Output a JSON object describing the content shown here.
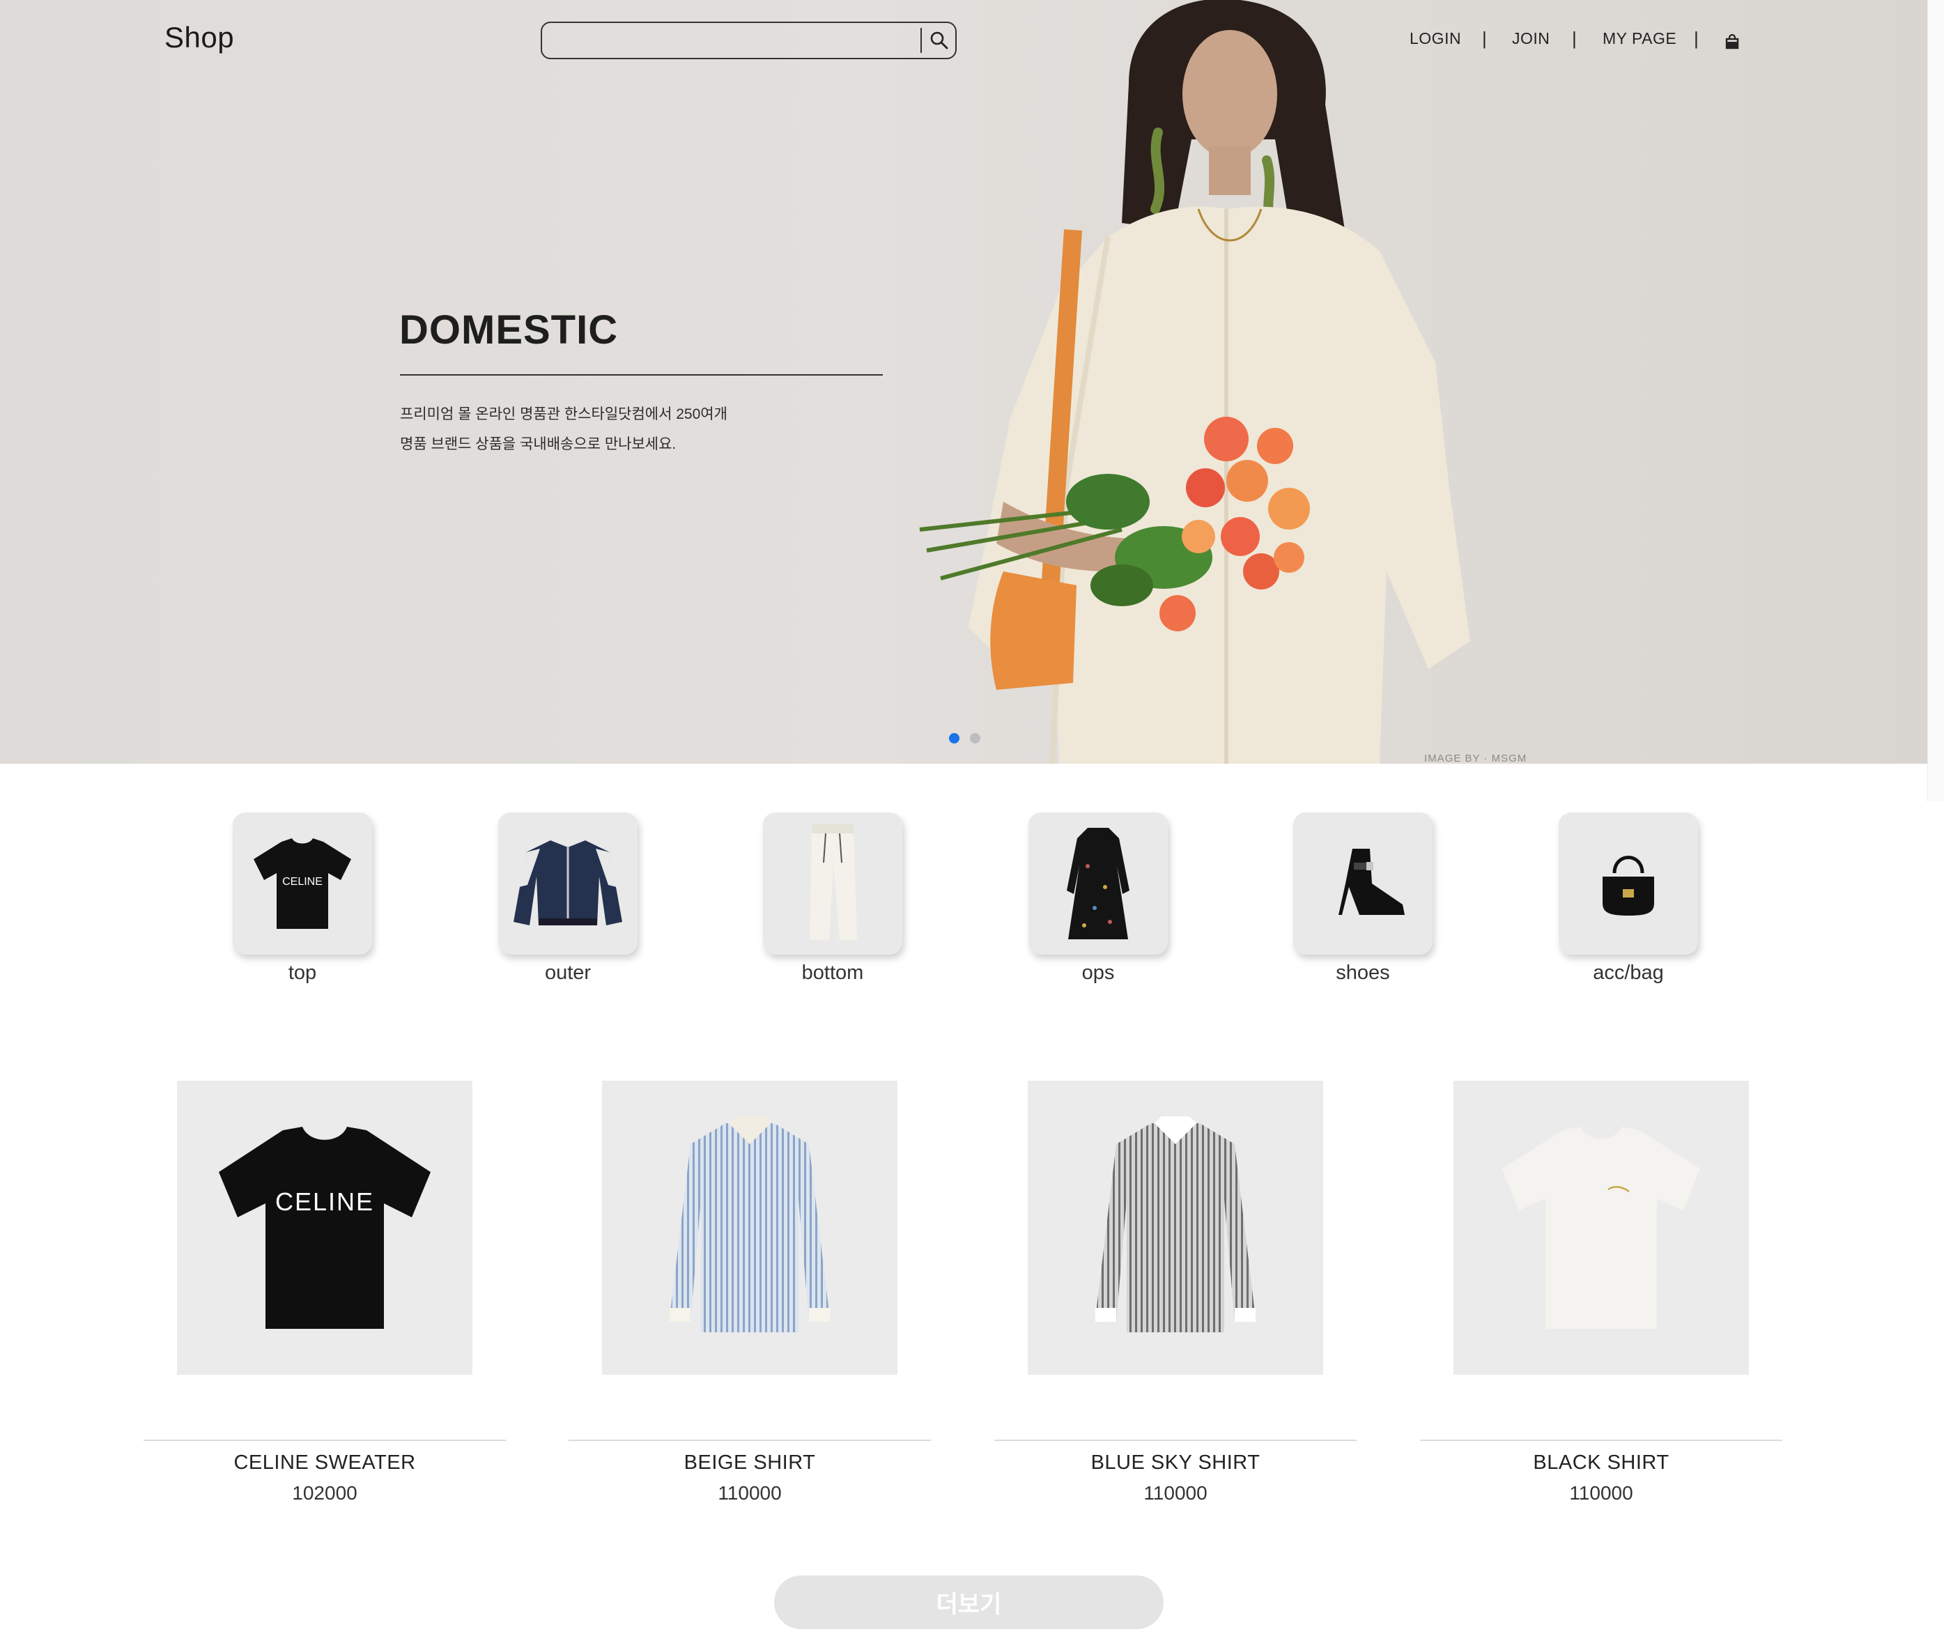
{
  "header": {
    "logo": "Shop",
    "search": {
      "value": "",
      "placeholder": ""
    },
    "nav": {
      "login": "LOGIN",
      "join": "JOIN",
      "mypage": "MY PAGE",
      "separator": "|"
    }
  },
  "hero": {
    "title": "DOMESTIC",
    "line1": "프리미엄 몰 온라인 명품관 한스타일닷컴에서 250여개",
    "line2": "명품 브랜드 상품을 국내배송으로 만나보세요.",
    "credit": "IMAGE BY · MSGM",
    "active_slide": 1,
    "slide_count": 2,
    "colors": {
      "active_dot": "#1a73e8",
      "inactive_dot": "#bdbdbd"
    }
  },
  "categories": [
    {
      "label": "top",
      "icon": "tshirt-icon"
    },
    {
      "label": "outer",
      "icon": "jacket-icon"
    },
    {
      "label": "bottom",
      "icon": "pants-icon"
    },
    {
      "label": "ops",
      "icon": "dress-icon"
    },
    {
      "label": "shoes",
      "icon": "boot-icon"
    },
    {
      "label": "acc/bag",
      "icon": "bag-icon"
    }
  ],
  "products": [
    {
      "name": "CELINE SWEATER",
      "price": "102000",
      "print": "CELINE"
    },
    {
      "name": "BEIGE SHIRT",
      "price": "110000"
    },
    {
      "name": "BLUE SKY SHIRT",
      "price": "110000"
    },
    {
      "name": "BLACK SHIRT",
      "price": "110000"
    }
  ],
  "category_tee_print": "CELINE",
  "more_button": "더보기"
}
